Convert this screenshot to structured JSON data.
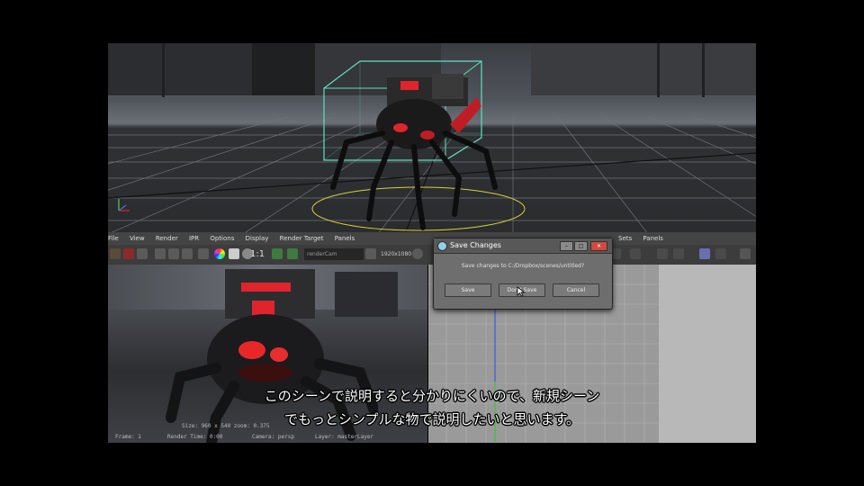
{
  "menubar": {
    "items": [
      "File",
      "View",
      "Render",
      "IPR",
      "Options",
      "Display",
      "Render Target",
      "Panels"
    ],
    "right_items": [
      "Sets",
      "Panels"
    ]
  },
  "toolbar": {
    "ratio_label": "1:1",
    "camera_field": "renderCam",
    "size_field": "1920x1080"
  },
  "render_hud": {
    "line1": "Size: 960 x 540  zoom: 0.375",
    "line2": "Frame: 1",
    "line3": "Render Time: 0:00",
    "line4": "Camera: persp",
    "line5": "Layer: masterLayer"
  },
  "dialog": {
    "title": "Save Changes",
    "message": "Save changes to C:/Dropbox/scenes/untitled?",
    "save_label": "Save",
    "dont_save_label": "Don't Save",
    "cancel_label": "Cancel",
    "minimize_glyph": "–",
    "maximize_glyph": "□",
    "close_glyph": "✕"
  },
  "subtitles": {
    "line1": "このシーンで説明すると分かりにくいので、新規シーン",
    "line2": "でもっとシンプルな物で説明したいと思います。"
  },
  "colors": {
    "selection_box": "#5de0c0",
    "accent_red": "#e0242c",
    "ground_circle": "#d6d23a",
    "grid": "#6e7278"
  }
}
